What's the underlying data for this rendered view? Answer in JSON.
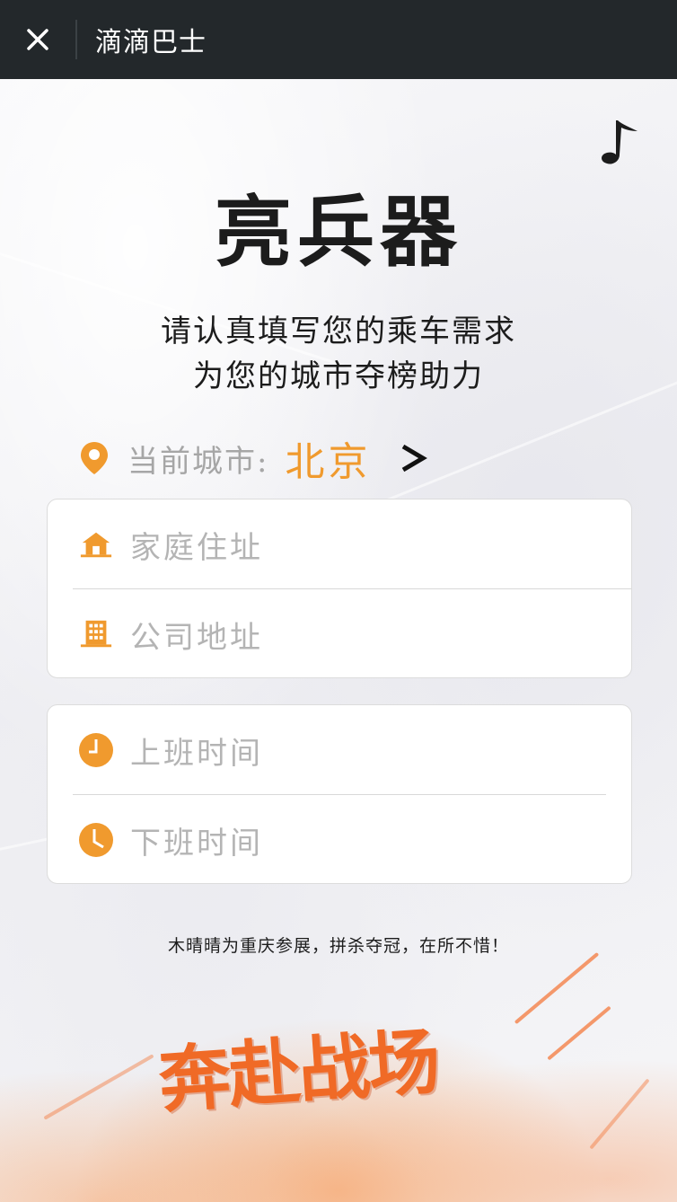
{
  "topbar": {
    "title": "滴滴巴士",
    "close_icon": "close-icon"
  },
  "page": {
    "music_icon": "music-note-icon",
    "headline": "亮兵器",
    "subline_1": "请认真填写您的乘车需求",
    "subline_2": "为您的城市夺榜助力"
  },
  "city": {
    "label": "当前城市:",
    "value": "北京",
    "pin_icon": "location-pin-icon",
    "arrow_icon": "chevron-right-icon"
  },
  "address_card": {
    "home_placeholder": "家庭住址",
    "home_icon": "home-icon",
    "company_placeholder": "公司地址",
    "company_icon": "building-icon"
  },
  "time_card": {
    "work_start_placeholder": "上班时间",
    "work_end_placeholder": "下班时间",
    "clock_icon": "clock-icon"
  },
  "slogan": "木晴晴为重庆参展，拼杀夺冠，在所不惜！",
  "banner_text": "奔赴战场",
  "colors": {
    "accent": "#f09a2e",
    "topbar": "#23282b",
    "banner": "#f06a26"
  }
}
